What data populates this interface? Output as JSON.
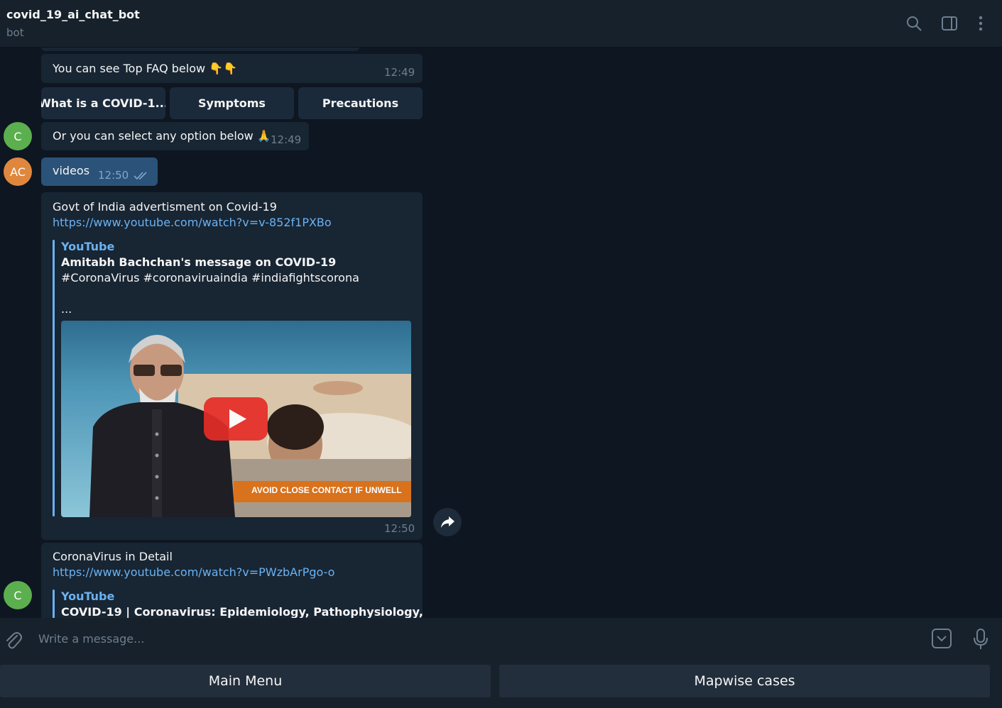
{
  "header": {
    "title": "covid_19_ai_chat_bot",
    "status": "bot"
  },
  "messages": {
    "faq_msg": {
      "text": "You can see Top FAQ below 👇👇",
      "time": "12:49"
    },
    "keyboard": [
      "What is a COVID-1...",
      "Symptoms",
      "Precautions"
    ],
    "select_msg": {
      "text": "Or you can select any option below 🙏",
      "time": "12:49",
      "avatar": "C"
    },
    "videos_msg": {
      "text": "videos",
      "time": "12:50",
      "avatar": "AC"
    },
    "video1": {
      "caption": "Govt of India advertisment on Covid-19",
      "url": "https://www.youtube.com/watch?v=v-852f1PXBo",
      "site": "YouTube",
      "title": "Amitabh Bachchan's message on COVID-19",
      "desc": "#CoronaVirus #coronaviruaindia #indiafightscorona",
      "ellipsis": "...",
      "banner": "AVOID CLOSE CONTACT IF UNWELL",
      "time": "12:50"
    },
    "video2": {
      "caption": "CoronaVirus in Detail",
      "url": "https://www.youtube.com/watch?v=PWzbArPgo-o",
      "site": "YouTube",
      "title": "COVID-19 | Coronavirus: Epidemiology, Pathophysiology,",
      "avatar": "C"
    }
  },
  "input": {
    "placeholder": "Write a message..."
  },
  "reply_keyboard": [
    "Main Menu",
    "Mapwise cases"
  ],
  "colors": {
    "background": "#0e1621",
    "panel": "#17212b",
    "bubble_in": "#182533",
    "bubble_out": "#2b5278",
    "link": "#6ab2f2",
    "avatar_c": "#5caf4f",
    "avatar_ac": "#e0873e"
  }
}
